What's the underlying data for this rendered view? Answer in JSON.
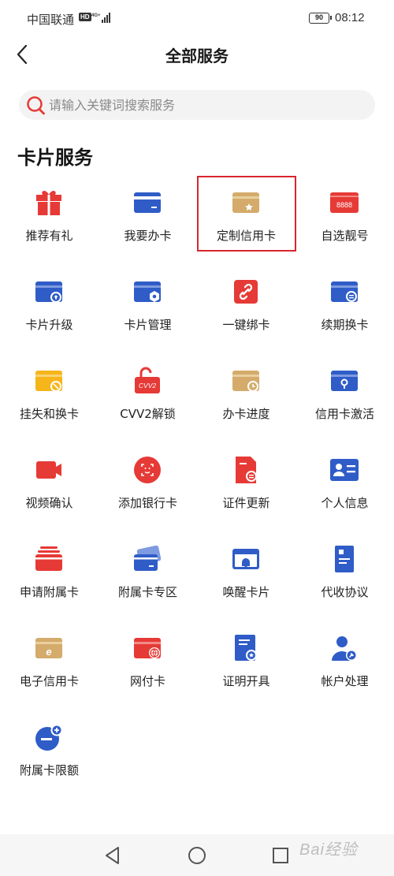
{
  "status_bar": {
    "carrier": "中国联通",
    "hd": "HD",
    "battery": "90",
    "time": "08:12"
  },
  "header": {
    "title": "全部服务"
  },
  "search": {
    "placeholder": "请输入关键词搜索服务"
  },
  "section": {
    "title": "卡片服务"
  },
  "colors": {
    "red": "#e63a36",
    "blue": "#2f5cc7",
    "gold": "#d4ab6a",
    "yellow": "#f5b51b",
    "highlight": "#d9252f"
  },
  "tiles": [
    {
      "label": "推荐有礼",
      "icon": "gift-icon"
    },
    {
      "label": "我要办卡",
      "icon": "card-icon"
    },
    {
      "label": "定制信用卡",
      "icon": "star-card-icon"
    },
    {
      "label": "自选靓号",
      "icon": "number-card-icon",
      "icon_text": "8888"
    },
    {
      "label": "卡片升级",
      "icon": "card-upgrade-icon"
    },
    {
      "label": "卡片管理",
      "icon": "card-manage-icon"
    },
    {
      "label": "一键绑卡",
      "icon": "link-icon"
    },
    {
      "label": "续期换卡",
      "icon": "card-renew-icon"
    },
    {
      "label": "挂失和换卡",
      "icon": "card-lost-icon"
    },
    {
      "label": "CVV2解锁",
      "icon": "cvv2-unlock-icon",
      "icon_text": "CVV2"
    },
    {
      "label": "办卡进度",
      "icon": "card-progress-icon"
    },
    {
      "label": "信用卡激活",
      "icon": "card-activate-icon"
    },
    {
      "label": "视频确认",
      "icon": "video-icon"
    },
    {
      "label": "添加银行卡",
      "icon": "face-scan-icon"
    },
    {
      "label": "证件更新",
      "icon": "document-update-icon"
    },
    {
      "label": "个人信息",
      "icon": "id-card-icon"
    },
    {
      "label": "申请附属卡",
      "icon": "card-stack-icon"
    },
    {
      "label": "附属卡专区",
      "icon": "card-pair-icon"
    },
    {
      "label": "唤醒卡片",
      "icon": "bell-card-icon"
    },
    {
      "label": "代收协议",
      "icon": "agreement-icon"
    },
    {
      "label": "电子信用卡",
      "icon": "e-card-icon"
    },
    {
      "label": "网付卡",
      "icon": "globe-card-icon"
    },
    {
      "label": "证明开具",
      "icon": "certificate-icon"
    },
    {
      "label": "帐户处理",
      "icon": "account-icon"
    },
    {
      "label": "附属卡限额",
      "icon": "limit-icon"
    }
  ],
  "nav": {
    "back": "back-triangle-icon",
    "home": "home-circle-icon",
    "recent": "recent-square-icon"
  },
  "watermark": "Bai经验"
}
